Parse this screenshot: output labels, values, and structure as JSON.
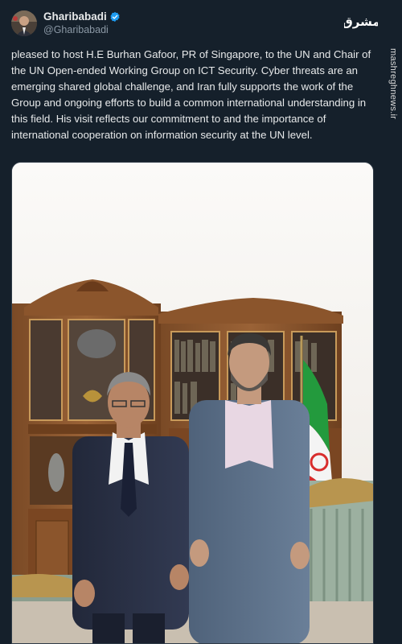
{
  "author": {
    "display_name": "Gharibabadi",
    "handle": "@Gharibabadi",
    "verified": true,
    "avatar_icon": "profile-photo"
  },
  "watermark": {
    "logo_text": "مشرق",
    "side_text": "mashreghnews.ir"
  },
  "tweet": {
    "text": "pleased to host H.E Burhan Gafoor, PR of Singapore, to the UN and Chair of the UN Open-ended Working Group on ICT Security. Cyber threats are an emerging shared global challenge, and Iran fully supports the work of the Group and ongoing efforts to build a common international understanding in this field. His visit reflects our commitment to and the importance of international cooperation on information security at the UN level."
  },
  "media": {
    "type": "photo"
  },
  "colors": {
    "background": "#15202b",
    "text": "#e7e9ea",
    "muted": "#8b98a5",
    "verified": "#1d9bf0"
  }
}
